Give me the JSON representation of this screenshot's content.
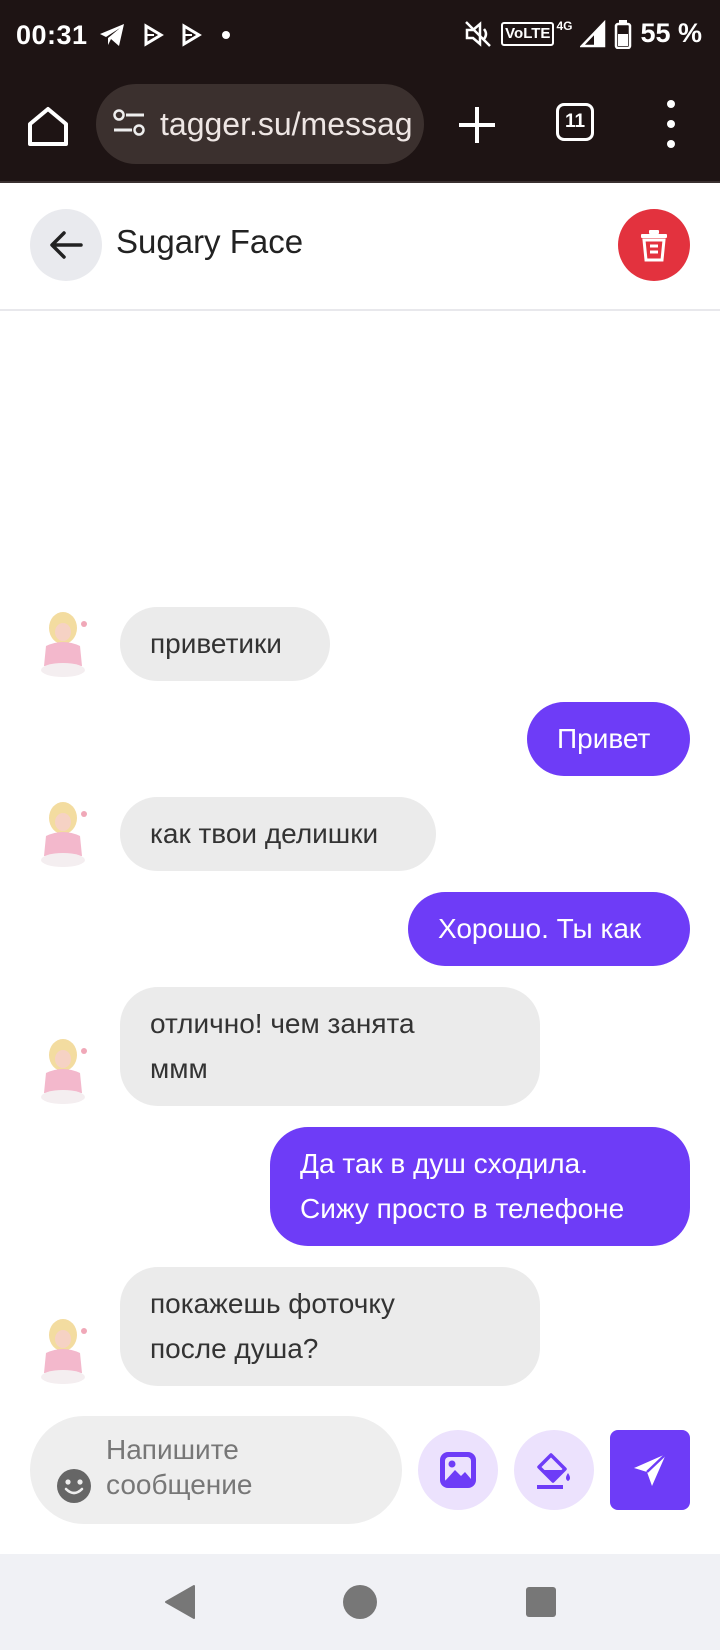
{
  "status_bar": {
    "time": "00:31",
    "network": "VoLTE",
    "network_type": "4G",
    "battery": "55 %",
    "left_icons": [
      "telegram-icon",
      "play-icon",
      "play-icon",
      "dot-icon"
    ],
    "right_icons": [
      "mute-icon",
      "volte-icon",
      "signal-icon",
      "battery-icon"
    ]
  },
  "browser": {
    "url": "tagger.su/messag",
    "tab_count": "11"
  },
  "chat": {
    "contact_name": "Sugary Face",
    "messages": [
      {
        "direction": "in",
        "text": "приветики"
      },
      {
        "direction": "out",
        "text": "Привет"
      },
      {
        "direction": "in",
        "text": "как твои делишки"
      },
      {
        "direction": "out",
        "text": "Хорошо. Ты как"
      },
      {
        "direction": "in",
        "lines": [
          "отлично! чем занята",
          "ммм"
        ]
      },
      {
        "direction": "out",
        "lines": [
          "Да так в душ сходила.",
          "Сижу просто в телефоне"
        ]
      },
      {
        "direction": "in",
        "lines": [
          "покажешь фоточку",
          "после душа?"
        ]
      }
    ]
  },
  "composer": {
    "placeholder_line1": "Напишите",
    "placeholder_line2": "сообщение"
  },
  "colors": {
    "accent": "#6e3cf7",
    "delete": "#e3323e",
    "incoming_bubble": "#ebebeb",
    "browser_chrome": "#1e1414"
  }
}
